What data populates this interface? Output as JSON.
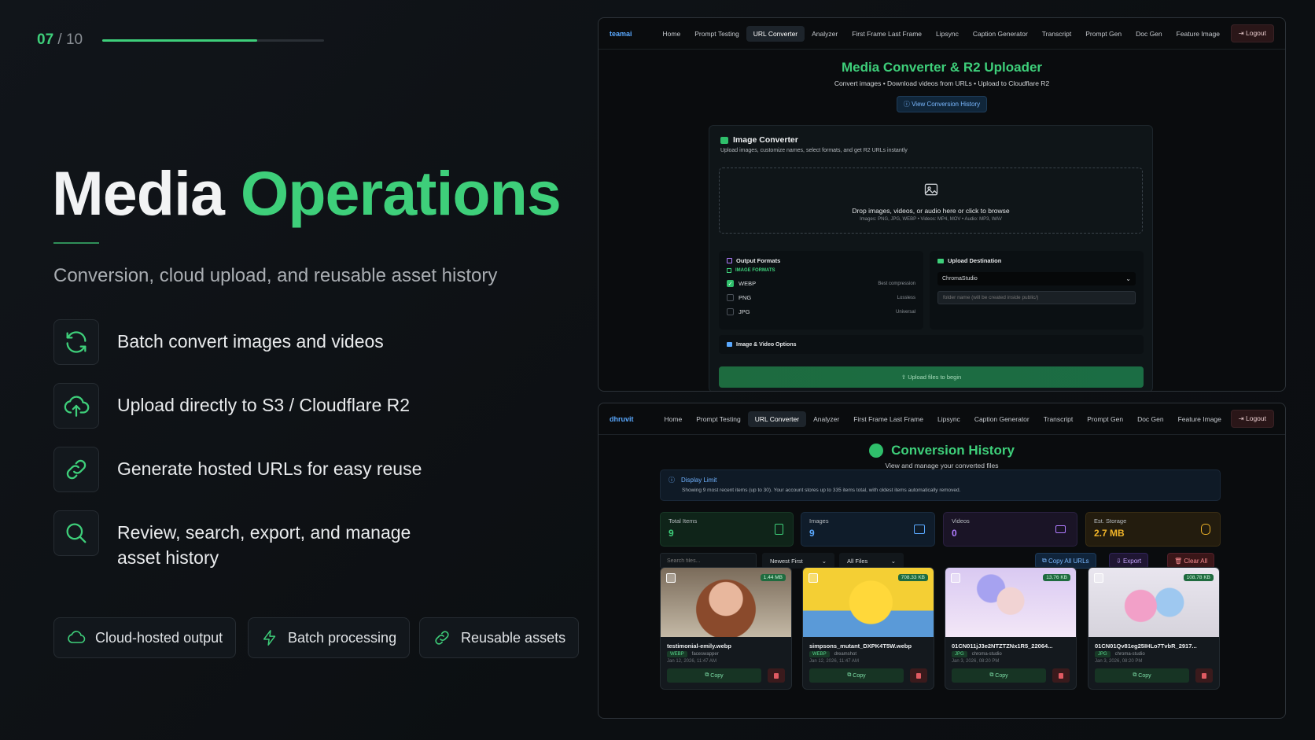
{
  "slide": {
    "counter_current": "07",
    "counter_total": "/ 10",
    "progress": 0.7,
    "title_main": "Media",
    "title_accent": "Operations",
    "subtitle": "Conversion, cloud upload, and reusable asset history",
    "features": [
      {
        "icon": "refresh-icon",
        "text": "Batch convert images and videos"
      },
      {
        "icon": "cloud-upload-icon",
        "text": "Upload directly to S3 / Cloudflare R2"
      },
      {
        "icon": "link-icon",
        "text": "Generate hosted URLs for easy reuse"
      },
      {
        "icon": "search-icon",
        "text": "Review, search, export, and manage asset history"
      }
    ],
    "pills": [
      {
        "icon": "cloud-icon",
        "label": "Cloud-hosted output"
      },
      {
        "icon": "bolt-icon",
        "label": "Batch processing"
      },
      {
        "icon": "link-icon",
        "label": "Reusable assets"
      }
    ],
    "accent_color": "#3ecf7a"
  },
  "converter": {
    "brand": "teamai",
    "nav": [
      "Home",
      "Prompt Testing",
      "URL Converter",
      "Analyzer",
      "First Frame Last Frame",
      "Lipsync",
      "Caption Generator",
      "Transcript",
      "Prompt Gen",
      "Doc Gen",
      "Feature Image"
    ],
    "active_nav": "URL Converter",
    "logout": "Logout",
    "title": "Media Converter & R2 Uploader",
    "subtitle": "Convert images • Download videos from URLs • Upload to Cloudflare R2",
    "history_button": "View Conversion History",
    "card_title": "Image Converter",
    "card_subtitle": "Upload images, customize names, select formats, and get R2 URLs instantly",
    "drop_text": "Drop images, videos, or audio here or click to browse",
    "drop_hint": "Images: PNG, JPG, WEBP • Videos: MP4, MOV • Audio: MP3, WAV",
    "output_formats": "Output Formats",
    "image_formats": "IMAGE FORMATS",
    "formats": [
      {
        "name": "WEBP",
        "desc": "Best compression",
        "checked": true
      },
      {
        "name": "PNG",
        "desc": "Lossless",
        "checked": false
      },
      {
        "name": "JPG",
        "desc": "Universal",
        "checked": false
      }
    ],
    "upload_destination": "Upload Destination",
    "destination_value": "ChromaStudio",
    "folder_placeholder": "folder name (will be created inside public/)",
    "options_label": "Image & Video Options",
    "upload_button": "Upload files to begin"
  },
  "history": {
    "brand": "dhruvit",
    "nav": [
      "Home",
      "Prompt Testing",
      "URL Converter",
      "Analyzer",
      "First Frame Last Frame",
      "Lipsync",
      "Caption Generator",
      "Transcript",
      "Prompt Gen",
      "Doc Gen",
      "Feature Image"
    ],
    "active_nav": "URL Converter",
    "logout": "Logout",
    "title": "Conversion History",
    "subtitle": "View and manage your converted files",
    "display_limit_title": "Display Limit",
    "display_limit_text": "Showing 9 most recent items (up to 30). Your account stores up to 335 items total, with oldest items automatically removed.",
    "stats": [
      {
        "label": "Total Items",
        "value": "9",
        "color": "#3ecf7a"
      },
      {
        "label": "Images",
        "value": "9",
        "color": "#5aa9ff"
      },
      {
        "label": "Videos",
        "value": "0",
        "color": "#b07cff"
      },
      {
        "label": "Est. Storage",
        "value": "2.7 MB",
        "color": "#f0b429"
      }
    ],
    "search_placeholder": "Search files...",
    "sort_value": "Newest First",
    "filter_value": "All Files",
    "copy_all": "Copy All URLs",
    "export": "Export",
    "clear_all": "Clear All",
    "items": [
      {
        "file": "testimonial-emily.webp",
        "size": "1.44 MB",
        "tag": "WEBP",
        "source": "faceswapper",
        "date": "Jan 12, 2026, 11:47 AM",
        "copy": "Copy"
      },
      {
        "file": "simpsons_mutant_DXPK4T5W.webp",
        "size": "708.33 KB",
        "tag": "WEBP",
        "source": "dreamshot",
        "date": "Jan 12, 2026, 11:47 AM",
        "copy": "Copy"
      },
      {
        "file": "01CN011jJ3e2NTZTZNx1R5_22064...",
        "size": "13.76 KB",
        "tag": "JPG",
        "source": "chroma-studio",
        "date": "Jan 3, 2026, 08:20 PM",
        "copy": "Copy"
      },
      {
        "file": "01CN01Qv81eg25IHLo7TvbR_2917...",
        "size": "108.78 KB",
        "tag": "JPG",
        "source": "chroma-studio",
        "date": "Jan 3, 2026, 08:20 PM",
        "copy": "Copy"
      }
    ]
  }
}
